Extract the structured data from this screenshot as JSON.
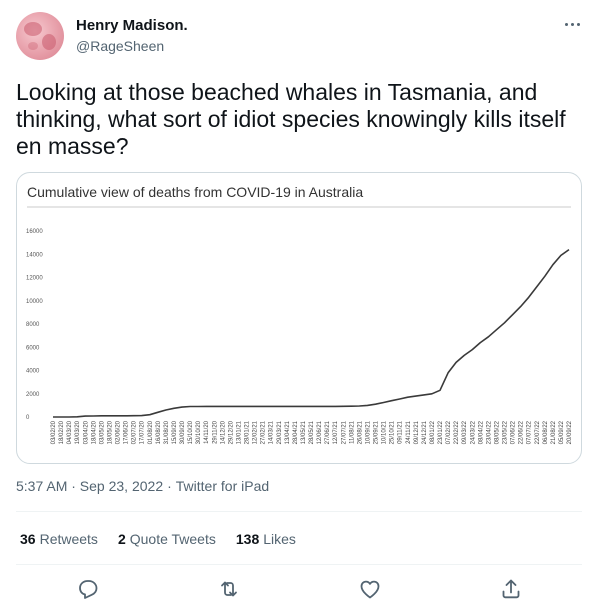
{
  "author": {
    "name": "Henry Madison.",
    "handle": "@RageSheen"
  },
  "tweet": {
    "text": "Looking at those beached whales in Tasmania, and thinking, what sort of idiot species knowingly kills itself en masse?",
    "timestamp": "5:37 AM · Sep 23, 2022",
    "source": "Twitter for iPad"
  },
  "stats": {
    "retweets_count": "36",
    "retweets_label": "Retweets",
    "quotes_count": "2",
    "quotes_label": "Quote Tweets",
    "likes_count": "138",
    "likes_label": "Likes"
  },
  "icons": {
    "more": "more-icon",
    "reply": "reply-icon",
    "retweet": "retweet-icon",
    "like": "heart-icon",
    "share": "share-icon"
  },
  "colors": {
    "line": "#3a3a3a",
    "muted": "#536471",
    "border": "#cfd9de"
  },
  "chart_data": {
    "type": "line",
    "title": "Cumulative view of deaths from COVID-19 in Australia",
    "xlabel": "",
    "ylabel": "",
    "ylim": [
      0,
      16000
    ],
    "yticks": [
      0,
      2000,
      4000,
      6000,
      8000,
      10000,
      12000,
      14000,
      16000
    ],
    "grid": false,
    "x": [
      "03/02/20",
      "18/02/20",
      "04/03/20",
      "19/03/20",
      "03/04/20",
      "18/04/20",
      "03/05/20",
      "18/05/20",
      "02/06/20",
      "17/06/20",
      "02/07/20",
      "17/07/20",
      "01/08/20",
      "16/08/20",
      "31/08/20",
      "15/09/20",
      "30/09/20",
      "15/10/20",
      "30/10/20",
      "14/11/20",
      "29/11/20",
      "14/12/20",
      "29/12/20",
      "13/01/21",
      "28/01/21",
      "12/02/21",
      "27/02/21",
      "14/03/21",
      "29/03/21",
      "13/04/21",
      "28/04/21",
      "13/05/21",
      "28/05/21",
      "12/06/21",
      "27/06/21",
      "12/07/21",
      "27/07/21",
      "11/08/21",
      "26/08/21",
      "10/09/21",
      "25/09/21",
      "10/10/21",
      "25/10/21",
      "09/11/21",
      "24/11/21",
      "09/12/21",
      "24/12/21",
      "08/01/22",
      "23/01/22",
      "07/02/22",
      "22/02/22",
      "09/03/22",
      "24/03/22",
      "08/04/22",
      "23/04/22",
      "08/05/22",
      "23/05/22",
      "07/06/22",
      "22/06/22",
      "07/07/22",
      "22/07/22",
      "06/08/22",
      "21/08/22",
      "05/09/22",
      "20/09/22"
    ],
    "values": [
      0,
      0,
      0,
      20,
      80,
      90,
      100,
      100,
      100,
      100,
      110,
      120,
      200,
      400,
      600,
      750,
      850,
      900,
      905,
      908,
      909,
      909,
      909,
      909,
      909,
      909,
      909,
      909,
      909,
      910,
      910,
      910,
      910,
      910,
      910,
      915,
      920,
      930,
      950,
      1000,
      1100,
      1250,
      1400,
      1550,
      1700,
      1800,
      1900,
      2000,
      2300,
      3800,
      4700,
      5300,
      5800,
      6400,
      6900,
      7500,
      8100,
      8800,
      9500,
      10300,
      11200,
      12100,
      13100,
      13900,
      14400
    ],
    "series": [
      {
        "name": "",
        "values_ref": "values"
      }
    ]
  }
}
